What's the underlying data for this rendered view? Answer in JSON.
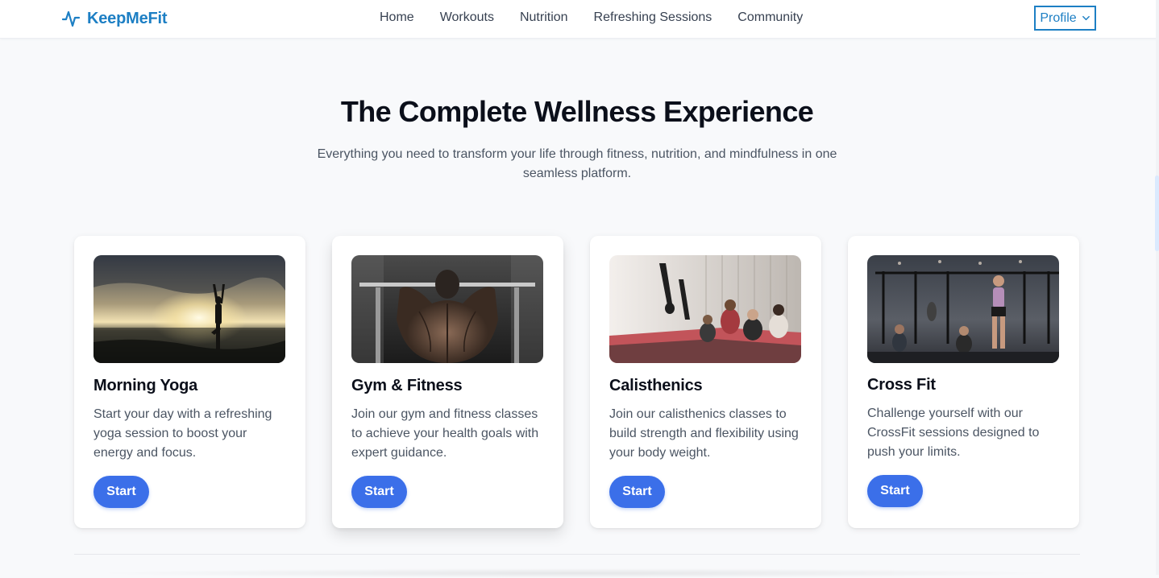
{
  "brand": {
    "name": "KeepMeFit",
    "icon": "pulse-icon",
    "color": "#1d7fc4"
  },
  "nav": {
    "links": [
      "Home",
      "Workouts",
      "Nutrition",
      "Refreshing Sessions",
      "Community"
    ],
    "profile_label": "Profile",
    "profile_icon": "chevron-down-icon"
  },
  "hero": {
    "title": "The Complete Wellness Experience",
    "subtitle": "Everything you need to transform your life through fitness, nutrition, and mindfulness in one seamless platform."
  },
  "cards": [
    {
      "title": "Morning Yoga",
      "description": "Start your day with a refreshing yoga session to boost your energy and focus.",
      "button": "Start",
      "image": "yoga-at-sunset-photo"
    },
    {
      "title": "Gym & Fitness",
      "description": "Join our gym and fitness classes to achieve your health goals with expert guidance.",
      "button": "Start",
      "image": "gym-back-workout-photo"
    },
    {
      "title": "Calisthenics",
      "description": "Join our calisthenics classes to build strength and flexibility using your body weight.",
      "button": "Start",
      "image": "calisthenics-class-photo"
    },
    {
      "title": "Cross Fit",
      "description": "Challenge yourself with our CrossFit sessions designed to push your limits.",
      "button": "Start",
      "image": "crossfit-gym-photo"
    }
  ],
  "colors": {
    "accent": "#3b6fe9",
    "brand": "#1d7fc4",
    "background": "#f8f9fb"
  }
}
